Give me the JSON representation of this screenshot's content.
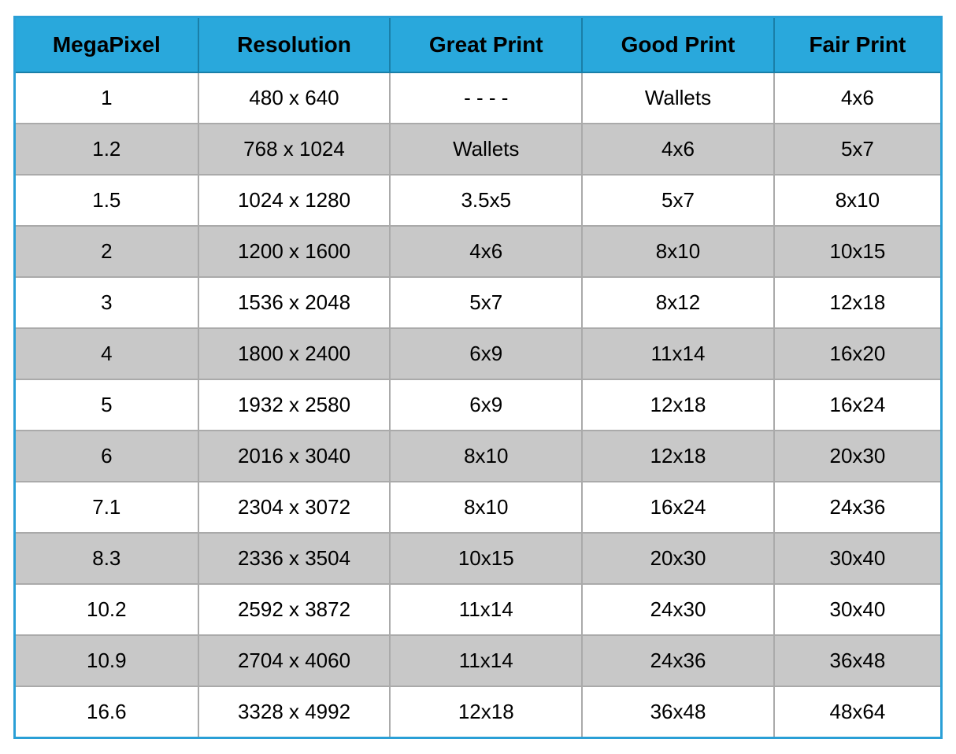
{
  "table": {
    "headers": [
      "MegaPixel",
      "Resolution",
      "Great Print",
      "Good Print",
      "Fair Print"
    ],
    "rows": [
      {
        "megapixel": "1",
        "resolution": "480 x 640",
        "great": "- - - -",
        "good": "Wallets",
        "fair": "4x6"
      },
      {
        "megapixel": "1.2",
        "resolution": "768 x 1024",
        "great": "Wallets",
        "good": "4x6",
        "fair": "5x7"
      },
      {
        "megapixel": "1.5",
        "resolution": "1024 x 1280",
        "great": "3.5x5",
        "good": "5x7",
        "fair": "8x10"
      },
      {
        "megapixel": "2",
        "resolution": "1200 x 1600",
        "great": "4x6",
        "good": "8x10",
        "fair": "10x15"
      },
      {
        "megapixel": "3",
        "resolution": "1536 x 2048",
        "great": "5x7",
        "good": "8x12",
        "fair": "12x18"
      },
      {
        "megapixel": "4",
        "resolution": "1800 x 2400",
        "great": "6x9",
        "good": "11x14",
        "fair": "16x20"
      },
      {
        "megapixel": "5",
        "resolution": "1932 x 2580",
        "great": "6x9",
        "good": "12x18",
        "fair": "16x24"
      },
      {
        "megapixel": "6",
        "resolution": "2016 x 3040",
        "great": "8x10",
        "good": "12x18",
        "fair": "20x30"
      },
      {
        "megapixel": "7.1",
        "resolution": "2304 x 3072",
        "great": "8x10",
        "good": "16x24",
        "fair": "24x36"
      },
      {
        "megapixel": "8.3",
        "resolution": "2336 x 3504",
        "great": "10x15",
        "good": "20x30",
        "fair": "30x40"
      },
      {
        "megapixel": "10.2",
        "resolution": "2592 x 3872",
        "great": "11x14",
        "good": "24x30",
        "fair": "30x40"
      },
      {
        "megapixel": "10.9",
        "resolution": "2704 x 4060",
        "great": "11x14",
        "good": "24x36",
        "fair": "36x48"
      },
      {
        "megapixel": "16.6",
        "resolution": "3328 x 4992",
        "great": "12x18",
        "good": "36x48",
        "fair": "48x64"
      }
    ]
  }
}
